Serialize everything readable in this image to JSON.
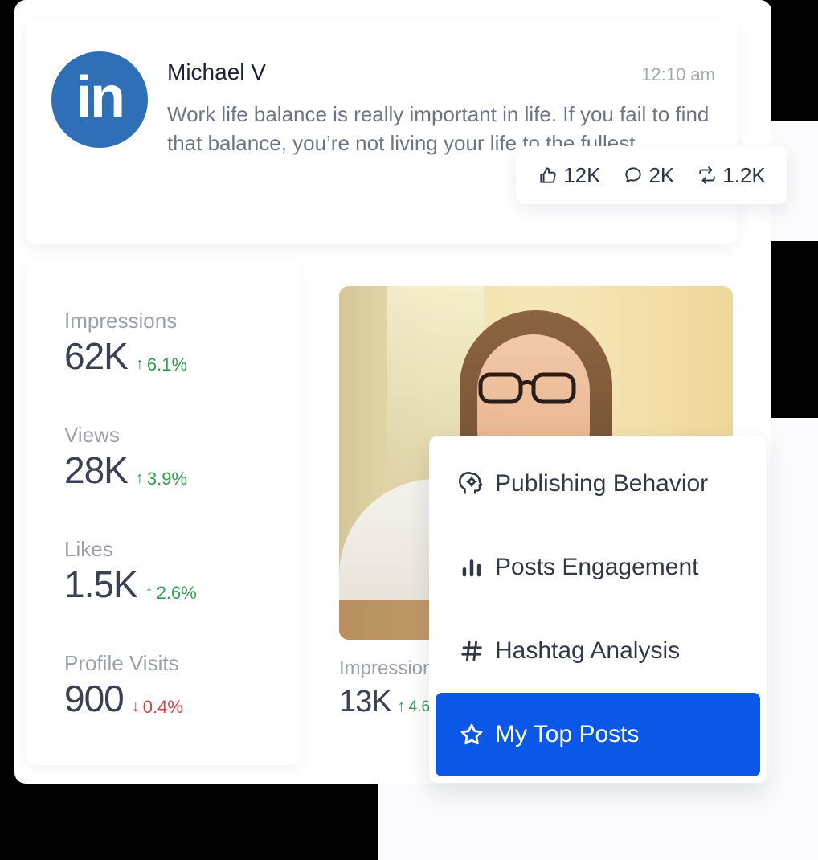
{
  "post": {
    "author": "Michael V",
    "time": "12:10 am",
    "text": "Work life balance is really important in life. If you fail to find that balance, you’re not living your life to the fullest.",
    "avatar_logo": "in",
    "avatar_color": "#2f6fb8"
  },
  "reactions": {
    "likes": "12K",
    "comments": "2K",
    "reposts": "1.2K",
    "icons": [
      "thumbs-up-icon",
      "comment-icon",
      "repost-icon"
    ]
  },
  "stats": [
    {
      "label": "Impressions",
      "value": "62K",
      "change": "6.1%",
      "direction": "up"
    },
    {
      "label": "Views",
      "value": "28K",
      "change": "3.9%",
      "direction": "up"
    },
    {
      "label": "Likes",
      "value": "1.5K",
      "change": "2.6%",
      "direction": "up"
    },
    {
      "label": "Profile Visits",
      "value": "900",
      "change": "0.4%",
      "direction": "down"
    }
  ],
  "photo_card": {
    "label": "Impressions",
    "value": "13K",
    "change": "4.6%",
    "direction": "up"
  },
  "menu": {
    "items": [
      {
        "label": "Publishing Behavior",
        "icon": "brain-gear-icon",
        "active": false
      },
      {
        "label": "Posts Engagement",
        "icon": "bar-chart-icon",
        "active": false
      },
      {
        "label": "Hashtag Analysis",
        "icon": "hashtag-icon",
        "active": false
      },
      {
        "label": "My Top Posts",
        "icon": "star-icon",
        "active": true
      }
    ]
  },
  "colors": {
    "accent": "#0b57e8",
    "up": "#2e9e4f",
    "down": "#d84040"
  }
}
